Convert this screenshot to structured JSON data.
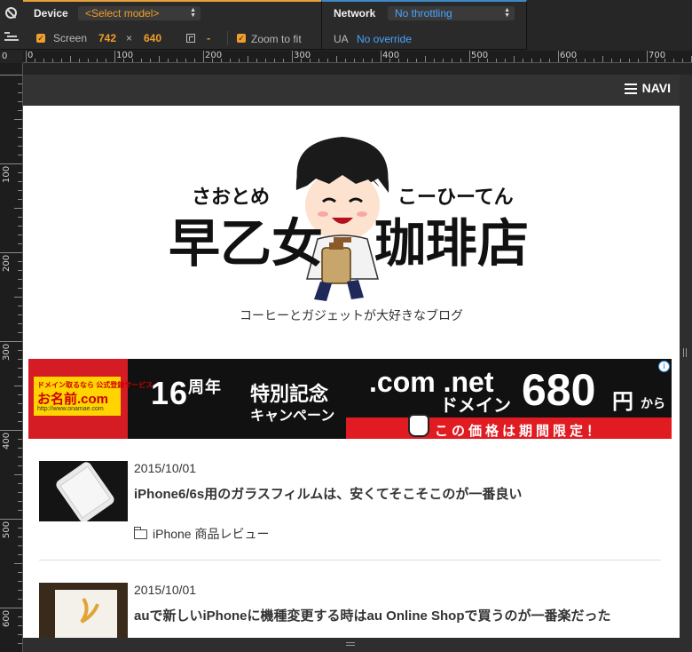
{
  "toolbar": {
    "device_label": "Device",
    "model_select": "<Select model>",
    "screen_label": "Screen",
    "screen_width": "742",
    "screen_x": "×",
    "screen_height": "640",
    "dpr_value": "-",
    "zoom_label": "Zoom to fit",
    "network_label": "Network",
    "throttling_select": "No throttling",
    "ua_label": "UA",
    "ua_value": "No override"
  },
  "rulers": {
    "corner": "0",
    "top": [
      "0",
      "100",
      "200",
      "300",
      "400",
      "500",
      "600",
      "700"
    ],
    "left": [
      "100",
      "200",
      "300",
      "400",
      "500",
      "600"
    ]
  },
  "site": {
    "navi_label": "NAVI",
    "logo_kana_left": "さおとめ",
    "logo_kana_right": "こーひーてん",
    "logo_kanji_left": "早乙女",
    "logo_kanji_right": "珈琲店",
    "tagline": "コーヒーとガジェットが大好きなブログ"
  },
  "ad": {
    "top_text": "ドメイン取るなら 公式登録サービス",
    "brand": "お名前.com",
    "url": "http://www.onamae.com",
    "anniv_num": "16",
    "anniv_kanji": "周年",
    "title": "特別記念",
    "campaign": "キャンペーン",
    "domains": ".com .net",
    "domain_sub": "ドメイン",
    "price": "680",
    "yen": "円",
    "kara": "から",
    "limited": "この価格は期間限定！",
    "info": "i"
  },
  "posts": [
    {
      "date": "2015/10/01",
      "title": "iPhone6/6s用のガラスフィルムは、安くてそこそこのが一番良い",
      "category": "iPhone 商品レビュー"
    },
    {
      "date": "2015/10/01",
      "title": "auで新しいiPhoneに機種変更する時はau Online Shopで買うのが一番楽だった",
      "category": ""
    }
  ]
}
